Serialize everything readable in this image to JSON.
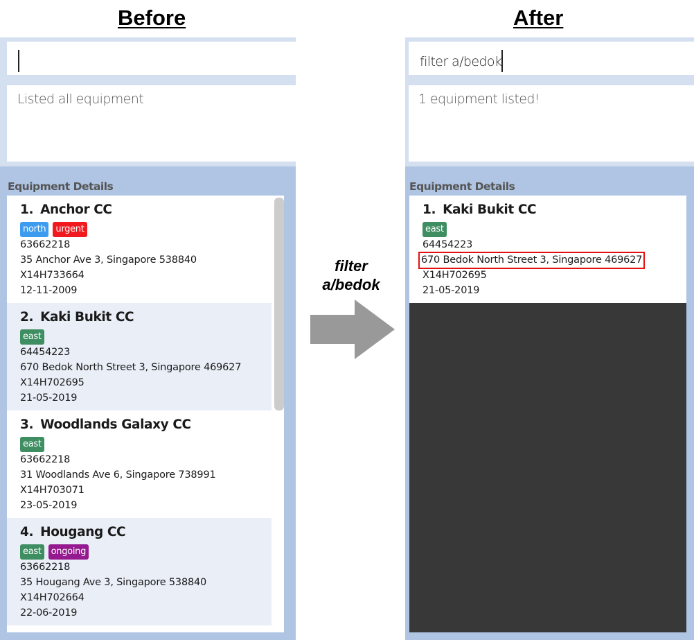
{
  "labels": {
    "before": "Before",
    "after": "After"
  },
  "transition": {
    "line1": "filter",
    "line2": "a/bedok"
  },
  "tag_colors": {
    "north": "#3d9cf0",
    "urgent": "#f11a1f",
    "east": "#3e8e62",
    "ongoing": "#95198f"
  },
  "highlight_color": "#e41010",
  "before": {
    "command_input": "",
    "result_message": "Listed all equipment",
    "list_title": "Equipment Details",
    "items": [
      {
        "index": "1.",
        "name": "Anchor CC",
        "tags": [
          "north",
          "urgent"
        ],
        "phone": "63662218",
        "address": "35 Anchor Ave 3, Singapore 538840",
        "serial": "X14H733664",
        "date": "12-11-2009"
      },
      {
        "index": "2.",
        "name": "Kaki Bukit CC",
        "tags": [
          "east"
        ],
        "phone": "64454223",
        "address": "670 Bedok North Street 3, Singapore 469627",
        "serial": "X14H702695",
        "date": "21-05-2019"
      },
      {
        "index": "3.",
        "name": "Woodlands Galaxy CC",
        "tags": [
          "east"
        ],
        "phone": "63662218",
        "address": "31 Woodlands Ave 6, Singapore 738991",
        "serial": "X14H703071",
        "date": "23-05-2019"
      },
      {
        "index": "4.",
        "name": "Hougang CC",
        "tags": [
          "east",
          "ongoing"
        ],
        "phone": "63662218",
        "address": "35 Hougang Ave 3, Singapore 538840",
        "serial": "X14H702664",
        "date": "22-06-2019"
      }
    ]
  },
  "after": {
    "command_input": "filter a/bedok",
    "result_message": "1 equipment listed!",
    "list_title": "Equipment Details",
    "items": [
      {
        "index": "1.",
        "name": "Kaki Bukit CC",
        "tags": [
          "east"
        ],
        "phone": "64454223",
        "address": "670 Bedok North Street 3, Singapore 469627",
        "serial": "X14H702695",
        "date": "21-05-2019",
        "address_highlighted": true
      }
    ]
  }
}
